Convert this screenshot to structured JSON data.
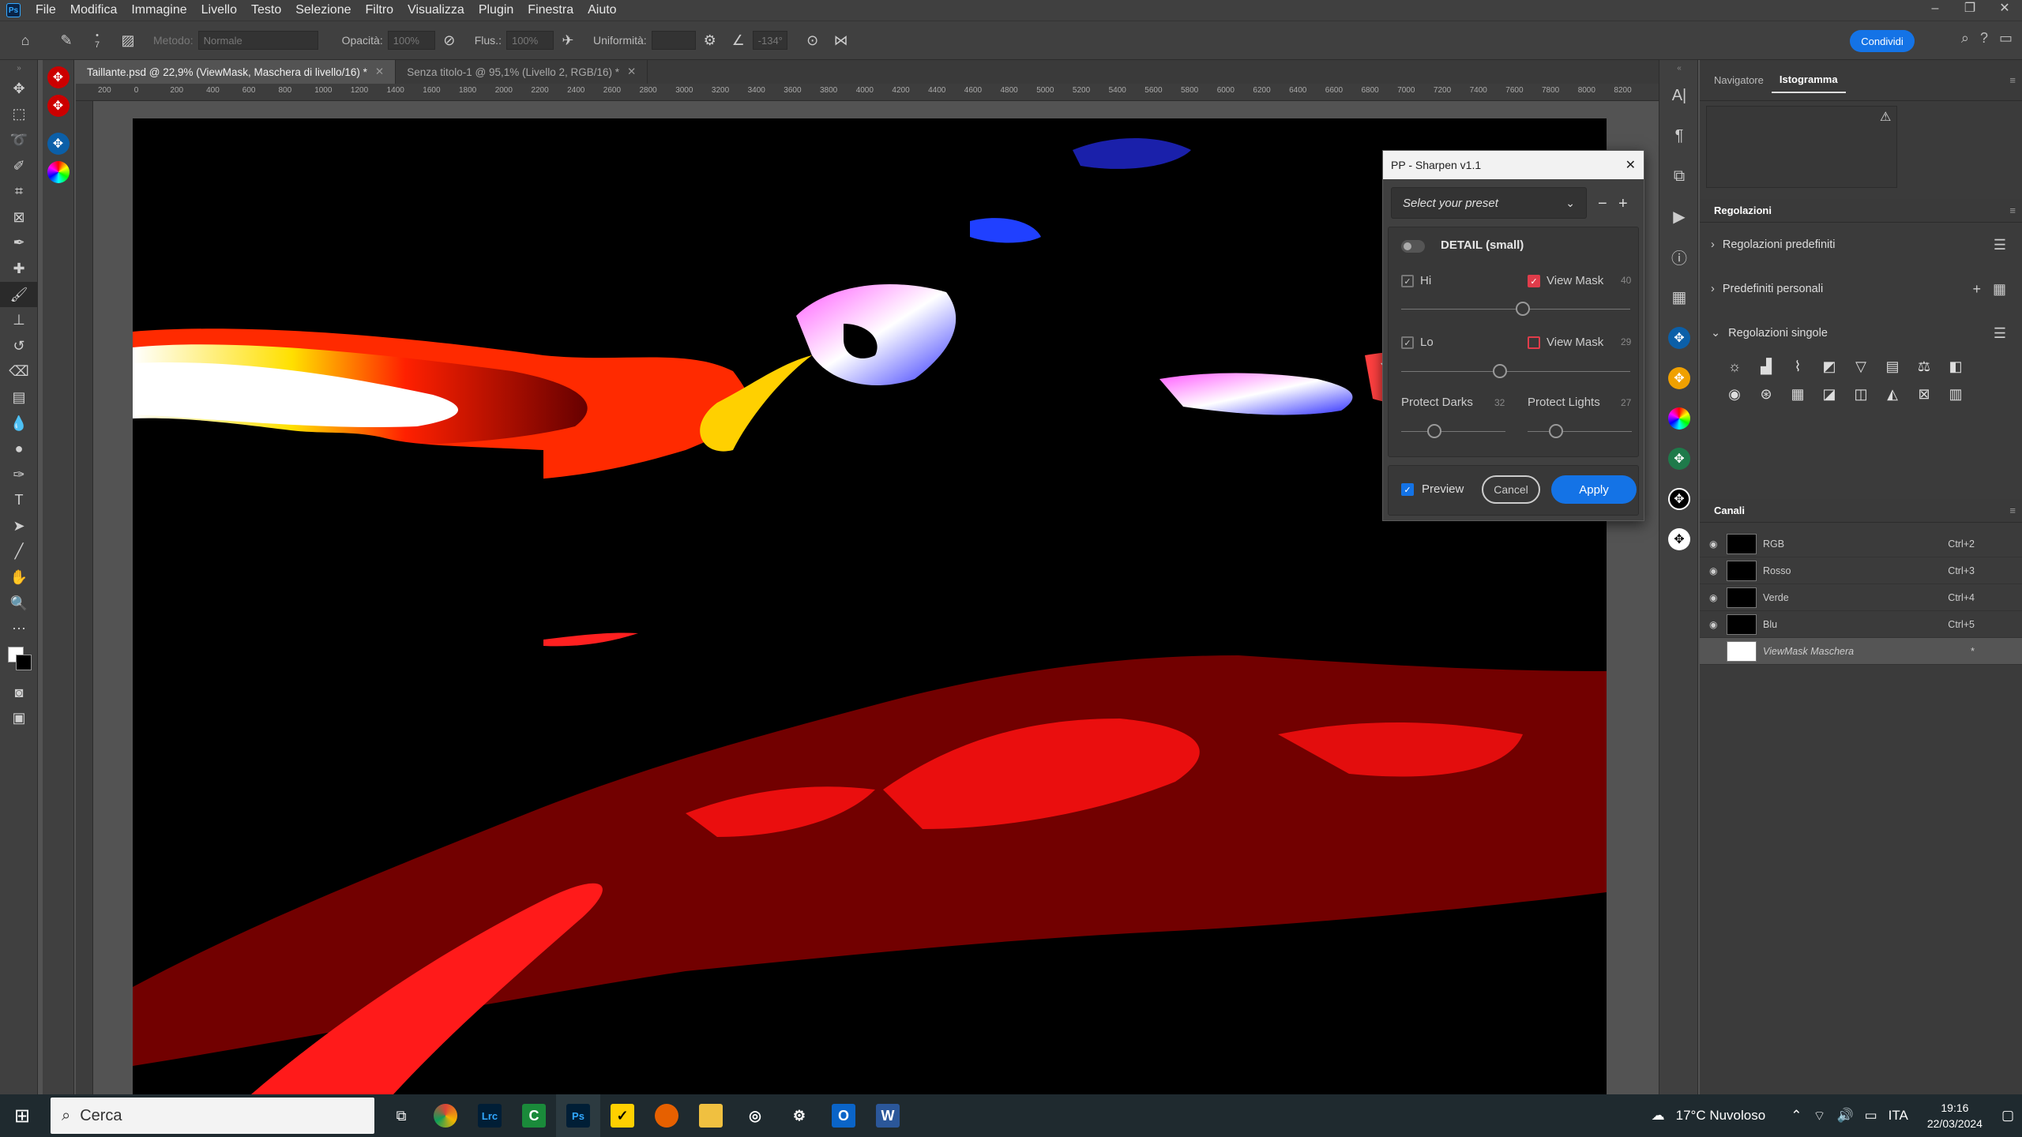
{
  "app": {
    "logo": "Ps"
  },
  "menubar": {
    "items": [
      "File",
      "Modifica",
      "Immagine",
      "Livello",
      "Testo",
      "Selezione",
      "Filtro",
      "Visualizza",
      "Plugin",
      "Finestra",
      "Aiuto"
    ]
  },
  "options": {
    "brush_size": "7",
    "mode_label": "Metodo:",
    "mode_value": "Normale",
    "opacity_label": "Opacità:",
    "opacity_value": "100%",
    "flow_label": "Flus.:",
    "flow_value": "100%",
    "smoothing_label": "Uniformità:",
    "angle_value": "-134°",
    "share_label": "Condividi"
  },
  "tabs": [
    {
      "label": "Taillante.psd @ 22,9% (ViewMask, Maschera di livello/16) *",
      "active": true
    },
    {
      "label": "Senza titolo-1 @ 95,1% (Livello 2, RGB/16) *",
      "active": false
    }
  ],
  "ruler": {
    "ticks": [
      "200",
      "0",
      "200",
      "400",
      "600",
      "800",
      "1000",
      "1200",
      "1400",
      "1600",
      "1800",
      "2000",
      "2200",
      "2400",
      "2600",
      "2800",
      "3000",
      "3200",
      "3400",
      "3600",
      "3800",
      "4000",
      "4200",
      "4400",
      "4600",
      "4800",
      "5000",
      "5200",
      "5400",
      "5600",
      "5800",
      "6000",
      "6200",
      "6400",
      "6600",
      "6800",
      "7000",
      "7200",
      "7400",
      "7600",
      "7800",
      "8000",
      "8200"
    ]
  },
  "dialog": {
    "title": "PP - Sharpen v1.1",
    "preset_placeholder": "Select your preset",
    "section_title": "DETAIL (small)",
    "hi_label": "Hi",
    "hi_viewmask_label": "View Mask",
    "hi_value": "40",
    "lo_label": "Lo",
    "lo_viewmask_label": "View Mask",
    "lo_value": "29",
    "protect_darks_label": "Protect Darks",
    "protect_darks_value": "32",
    "protect_lights_label": "Protect Lights",
    "protect_lights_value": "27",
    "preview_label": "Preview",
    "cancel_label": "Cancel",
    "apply_label": "Apply",
    "hi_level": 0.4,
    "lo_level": 0.29,
    "darks_level": 0.32,
    "lights_level": 0.27
  },
  "panels": {
    "nav_tab": "Navigatore",
    "hist_tab": "Istogramma",
    "adjust_title": "Regolazioni",
    "adjust_rows": [
      "Regolazioni predefiniti",
      "Predefiniti personali",
      "Regolazioni singole"
    ],
    "channels_title": "Canali",
    "channels": [
      {
        "name": "RGB",
        "shortcut": "Ctrl+2"
      },
      {
        "name": "Rosso",
        "shortcut": "Ctrl+3"
      },
      {
        "name": "Verde",
        "shortcut": "Ctrl+4"
      },
      {
        "name": "Blu",
        "shortcut": "Ctrl+5"
      },
      {
        "name": "ViewMask Maschera",
        "shortcut": "*"
      }
    ]
  },
  "taskbar": {
    "search_placeholder": "Cerca",
    "apps": [
      "Lrc",
      "Ps",
      "W"
    ],
    "weather": "17°C  Nuvoloso",
    "lang": "ITA",
    "time": "19:16",
    "date": "22/03/2024"
  },
  "colors": {
    "accent": "#1473e6",
    "red_mask": "#e03c4a"
  }
}
